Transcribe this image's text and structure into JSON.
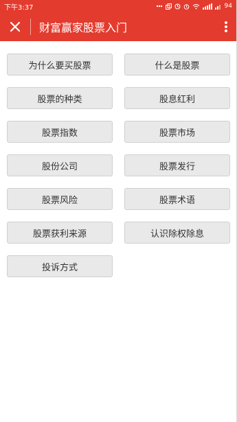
{
  "status_bar": {
    "time": "下午3:37",
    "battery": "94"
  },
  "header": {
    "title": "财富赢家股票入门"
  },
  "topics": [
    {
      "label": "为什么要买股票"
    },
    {
      "label": "什么是股票"
    },
    {
      "label": "股票的种类"
    },
    {
      "label": "股息红利"
    },
    {
      "label": "股票指数"
    },
    {
      "label": "股票市场"
    },
    {
      "label": "股份公司"
    },
    {
      "label": "股票发行"
    },
    {
      "label": "股票风险"
    },
    {
      "label": "股票术语"
    },
    {
      "label": "股票获利来源"
    },
    {
      "label": "认识除权除息"
    },
    {
      "label": "投诉方式"
    }
  ],
  "colors": {
    "header_bg": "#e33b2e",
    "button_bg": "#e9e9e9"
  },
  "icons": {
    "close": "close-icon",
    "more": "more-vertical-icon"
  }
}
